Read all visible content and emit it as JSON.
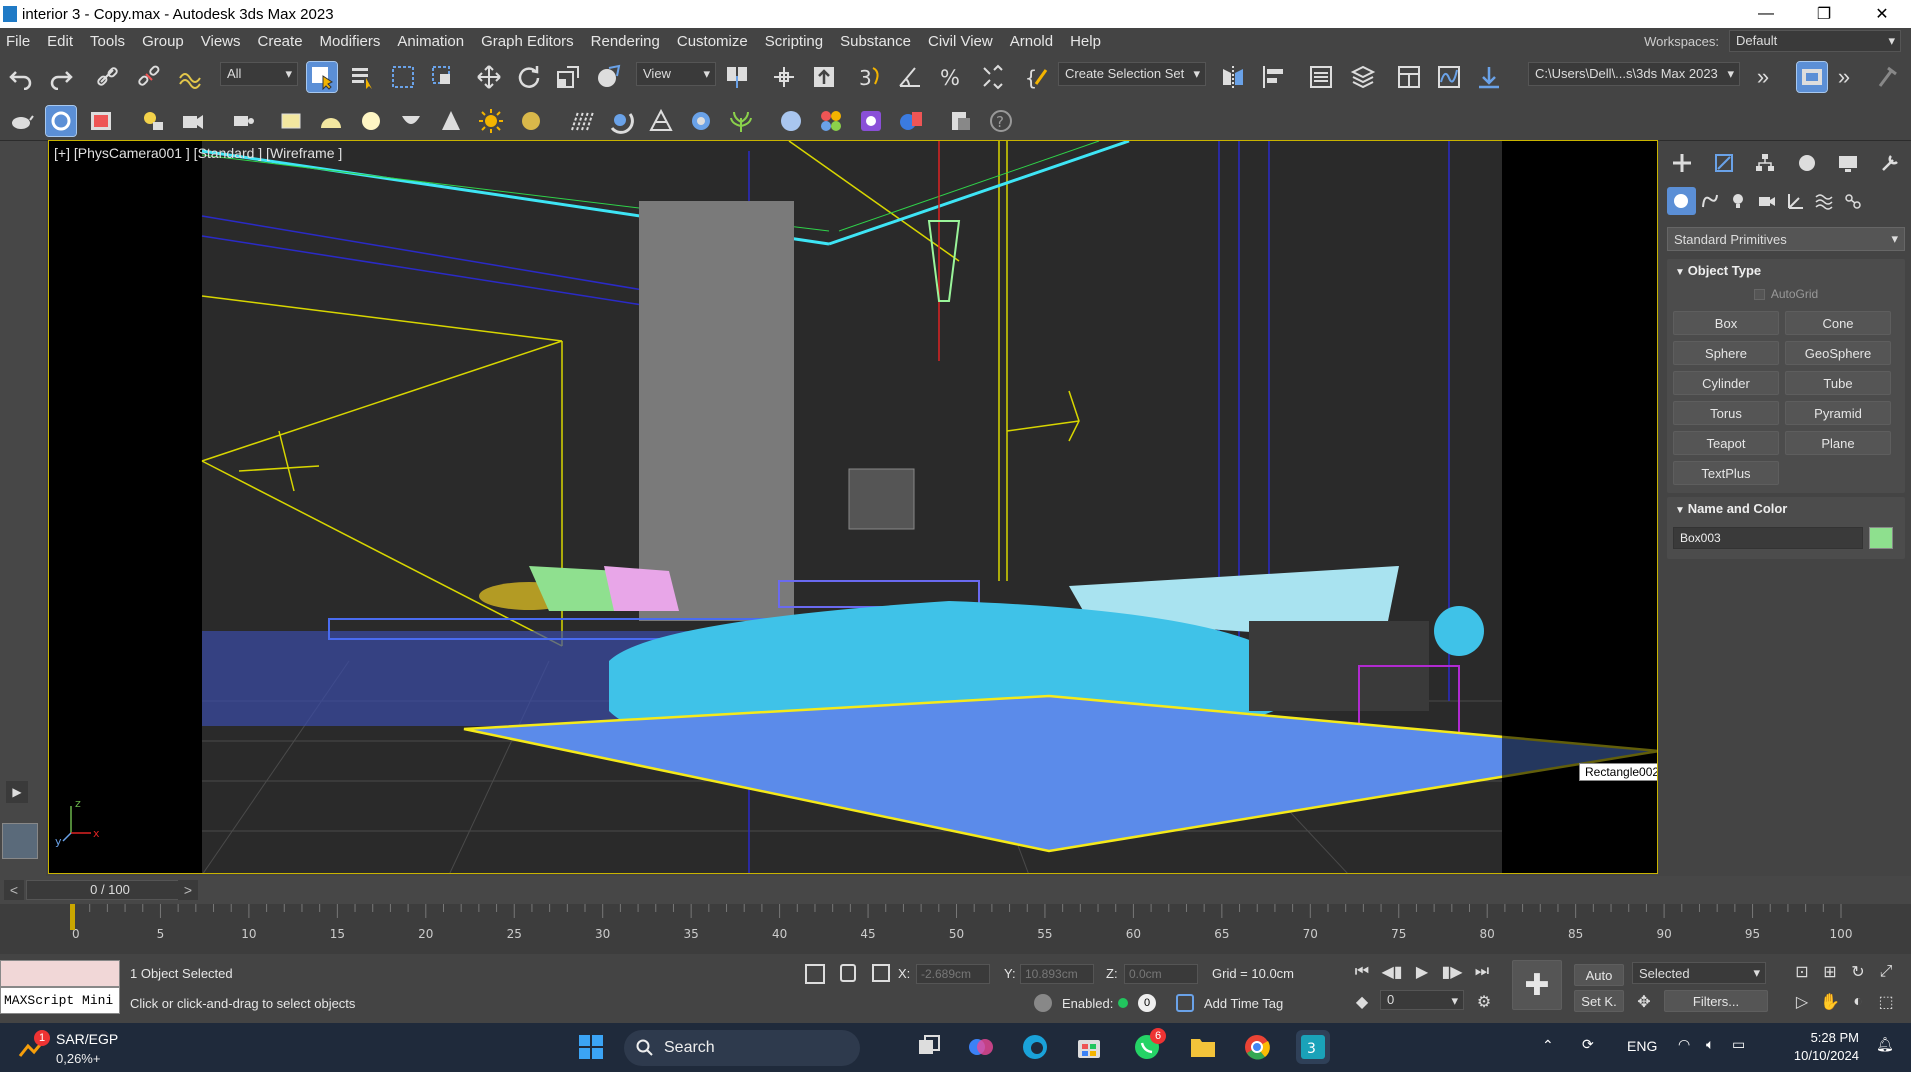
{
  "window": {
    "title": "interior 3 - Copy.max - Autodesk 3ds Max 2023",
    "minimize": "—",
    "restore": "❐",
    "close": "✕"
  },
  "menu": {
    "items": [
      "File",
      "Edit",
      "Tools",
      "Group",
      "Views",
      "Create",
      "Modifiers",
      "Animation",
      "Graph Editors",
      "Rendering",
      "Customize",
      "Scripting",
      "Substance",
      "Civil View",
      "Arnold",
      "Help"
    ],
    "workspaces_label": "Workspaces:",
    "workspace_value": "Default"
  },
  "toolbar": {
    "filter_value": "All",
    "ref_coord_value": "View",
    "named_selection_value": "Create Selection Set",
    "project_path": "C:\\Users\\Dell\\...s\\3ds Max 2023",
    "more": "»"
  },
  "viewport": {
    "label": "[+] [PhysCamera001 ] [Standard ] [Wireframe ]",
    "tooltip": "Rectangle002",
    "axis_x": "x",
    "axis_y": "y",
    "axis_z": "z"
  },
  "command_panel": {
    "category_value": "Standard Primitives",
    "object_type_title": "Object Type",
    "autogrid_label": "AutoGrid",
    "primitives": [
      "Box",
      "Cone",
      "Sphere",
      "GeoSphere",
      "Cylinder",
      "Tube",
      "Torus",
      "Pyramid",
      "Teapot",
      "Plane",
      "TextPlus"
    ],
    "name_color_title": "Name and Color",
    "object_name": "Box003",
    "object_color": "#8ee08e"
  },
  "timeline": {
    "frame_display": "0 / 100",
    "prev": "<",
    "next": ">",
    "ticks": [
      "0",
      "5",
      "10",
      "15",
      "20",
      "25",
      "30",
      "35",
      "40",
      "45",
      "50",
      "55",
      "60",
      "65",
      "70",
      "75",
      "80",
      "85",
      "90",
      "95",
      "100"
    ]
  },
  "status": {
    "maxscript_label": "MAXScript Mini",
    "selection_text": "1 Object Selected",
    "prompt_text": "Click or click-and-drag to select objects",
    "x_label": "X:",
    "x_value": "-2.689cm",
    "y_label": "Y:",
    "y_value": "10.893cm",
    "z_label": "Z:",
    "z_value": "0.0cm",
    "grid_text": "Grid = 10.0cm",
    "enabled_label": "Enabled:",
    "add_time_tag": "Add Time Tag",
    "auto_label": "Auto",
    "selected_value": "Selected",
    "setk_label": "Set K.",
    "filters_label": "Filters...",
    "frame_value": "0"
  },
  "taskbar": {
    "weather_title": "SAR/EGP",
    "weather_value": "0,26%+",
    "weather_badge": "1",
    "search_label": "Search",
    "whatsapp_badge": "6",
    "lang": "ENG",
    "time": "5:28 PM",
    "date": "10/10/2024"
  }
}
